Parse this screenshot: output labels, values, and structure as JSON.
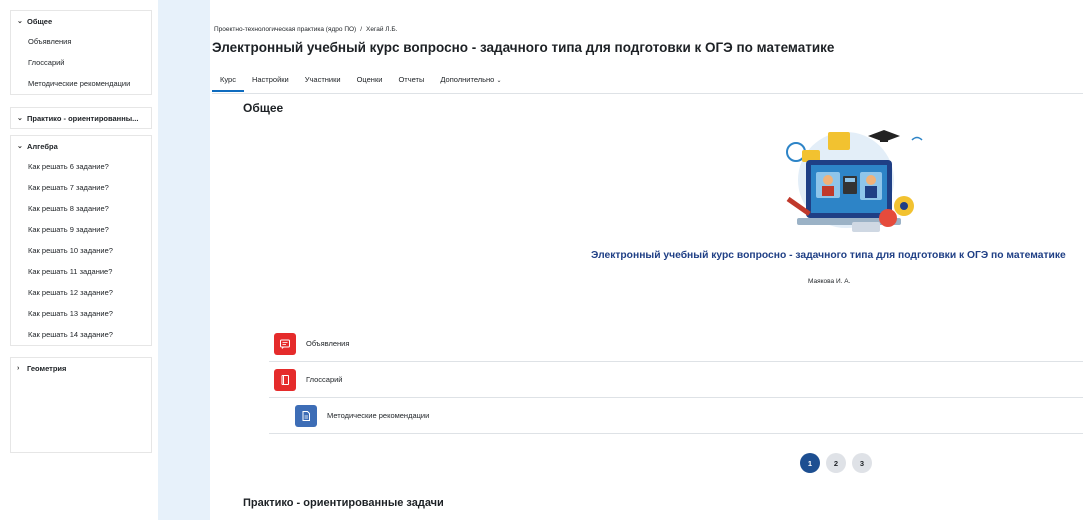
{
  "sidebar": {
    "sections": [
      {
        "title": "Общее",
        "expanded": true,
        "items": [
          "Объявления",
          "Глоссарий",
          "Методические рекомендации"
        ]
      },
      {
        "title": "Практико - ориентированны...",
        "expanded": true,
        "items": []
      },
      {
        "title": "Алгебра",
        "expanded": true,
        "items": [
          "Как решать 6 задание?",
          "Как решать 7 задание?",
          "Как решать 8 задание?",
          "Как решать 9 задание?",
          "Как решать 10 задание?",
          "Как решать 11 задание?",
          "Как решать 12 задание?",
          "Как решать 13 задание?",
          "Как решать 14 задание?"
        ]
      },
      {
        "title": "Геометрия",
        "expanded": false,
        "items": []
      }
    ]
  },
  "header": {
    "breadcrumb": [
      "Проектно-технологическая практика (ядро ПО)",
      "Хегай Л.Б."
    ],
    "breadcrumb_sep": "/",
    "title": "Электронный учебный курс вопросно - задачного типа для подготовки к ОГЭ по математике"
  },
  "tabs": [
    {
      "label": "Курс",
      "active": true
    },
    {
      "label": "Настройки",
      "active": false
    },
    {
      "label": "Участники",
      "active": false
    },
    {
      "label": "Оценки",
      "active": false
    },
    {
      "label": "Отчеты",
      "active": false
    },
    {
      "label": "Дополнительно",
      "active": false,
      "dropdown": true
    }
  ],
  "section": {
    "title": "Общее",
    "course_title": "Электронный учебный курс вопросно - задачного типа для подготовки к ОГЭ по математике",
    "author": "Маякова И. А.",
    "activities": [
      {
        "label": "Объявления",
        "icon": "forum-icon",
        "color": "#e52b2b"
      },
      {
        "label": "Глоссарий",
        "icon": "glossary-icon",
        "color": "#e52b2b"
      },
      {
        "label": "Методические рекомендации",
        "icon": "file-icon",
        "color": "#3d6db6"
      }
    ]
  },
  "pagination": {
    "pages": [
      "1",
      "2",
      "3"
    ],
    "current": "1"
  },
  "next_section": {
    "title": "Практико - ориентированные задачи"
  },
  "colors": {
    "accent": "#0f6cbf",
    "course_title": "#1f3f85",
    "band": "#e7f1fa",
    "red": "#e52b2b",
    "blue": "#3d6db6"
  }
}
